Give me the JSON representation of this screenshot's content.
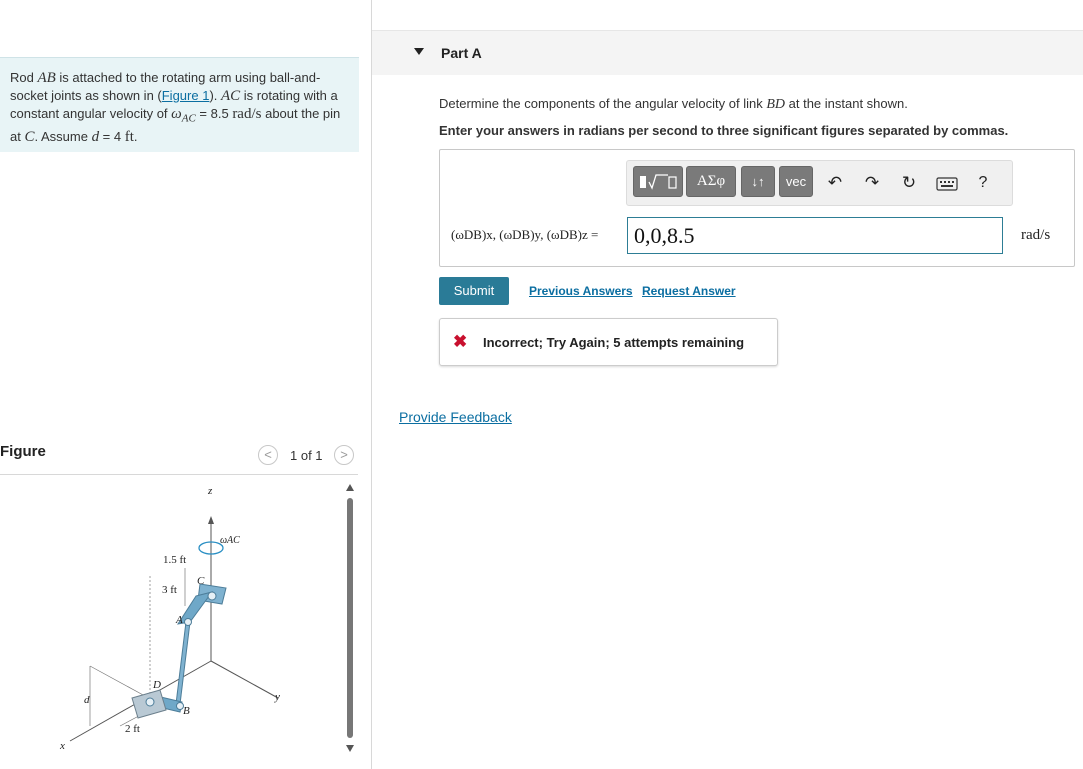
{
  "problem": {
    "t1": "Rod ",
    "m_ab": "AB",
    "t2": " is attached to the rotating arm using ball-and-socket joints as shown in (",
    "figure_link": "Figure 1",
    "t3": "). ",
    "m_ac": "AC",
    "t4": " is rotating with a constant angular velocity of ",
    "m_omega": "ω",
    "m_sub": "AC",
    "t5": " = 8.5 ",
    "m_unit": "rad/s",
    "t6": " about the pin at ",
    "m_c": "C",
    "t7": ". Assume ",
    "m_d": "d",
    "t8": " = 4 ",
    "m_ft": "ft",
    "t9": "."
  },
  "figure": {
    "label": "Figure",
    "pager": "1 of 1",
    "prev_glyph": "<",
    "next_glyph": ">",
    "labels": {
      "z": "z",
      "omega_ac": "ωAC",
      "dim_15": "1.5 ft",
      "dim_3": "3 ft",
      "c": "C",
      "a": "A",
      "d_pt": "D",
      "b": "B",
      "d_dim": "d",
      "dim_2": "2 ft",
      "x": "x",
      "y": "y"
    }
  },
  "part": {
    "title": "Part A",
    "question_pre": "Determine the components of the angular velocity of link ",
    "question_var": "BD",
    "question_post": " at the instant shown.",
    "instruction": "Enter your answers in radians per second to three significant figures separated by commas.",
    "answer_label": "(ωDB)x, (ωDB)y, (ωDB)z =",
    "answer_value": "0,0,8.5",
    "unit": "rad/s",
    "submit_label": "Submit",
    "previous_answers": "Previous Answers",
    "request_answer": "Request Answer",
    "feedback_icon": "✖",
    "feedback_text": "Incorrect; Try Again; 5 attempts remaining",
    "provide_feedback": "Provide Feedback"
  },
  "toolbar": {
    "templates_icon": "templates-icon",
    "greek_label": "ΑΣφ",
    "arrows_label": "↓↑",
    "vec_label": "vec",
    "help_label": "?"
  },
  "colors": {
    "accent": "#2a7b97",
    "problem_bg": "#e8f4f6",
    "link": "#0b6ea1",
    "error": "#c8102e",
    "figure_part": "#6fa8c8"
  }
}
